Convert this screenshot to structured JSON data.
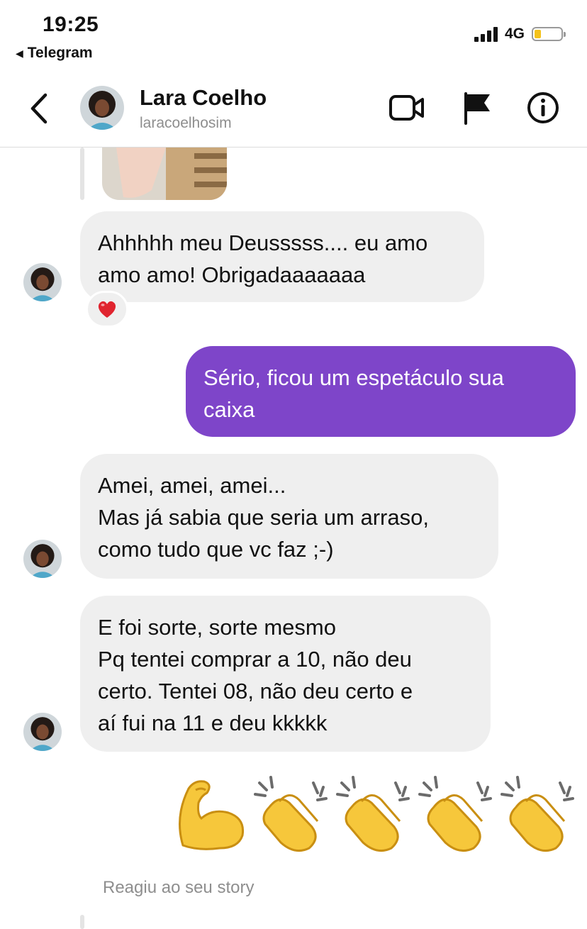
{
  "status_bar": {
    "time": "19:25",
    "back_app": "Telegram",
    "network": "4G",
    "battery_level": 0.25,
    "icons": [
      "signal-icon",
      "battery-icon"
    ]
  },
  "header": {
    "name": "Lara Coelho",
    "username": "laracoelhosim",
    "icons": [
      "back-icon",
      "video-call-icon",
      "flag-icon",
      "info-icon"
    ]
  },
  "messages": [
    {
      "direction": "in",
      "lines": [
        "Ahhhhh meu Deusssss.... eu amo",
        "amo amo! Obrigadaaaaaaa"
      ],
      "reaction": "❤️"
    },
    {
      "direction": "out",
      "lines": [
        "Sério, ficou um espetáculo sua",
        "caixa"
      ]
    },
    {
      "direction": "in",
      "lines": [
        "Amei, amei, amei...",
        "Mas já sabia que seria um arraso,",
        "como tudo que vc faz ;-)"
      ]
    },
    {
      "direction": "in",
      "lines": [
        "E foi sorte, sorte mesmo",
        "Pq tentei comprar a 10, não deu",
        "certo. Tentei 08, não deu certo e",
        "aí fui na 11 e deu kkkkk"
      ]
    }
  ],
  "emoji_message": [
    "💪",
    "👏",
    "👏",
    "👏",
    "👏"
  ],
  "story_caption": "Reagiu ao seu story",
  "colors": {
    "outgoing_bubble": "#7e45c9",
    "incoming_bubble": "#efefef",
    "secondary_text": "#8e8e8e",
    "reaction_heart": "#e0242f"
  }
}
